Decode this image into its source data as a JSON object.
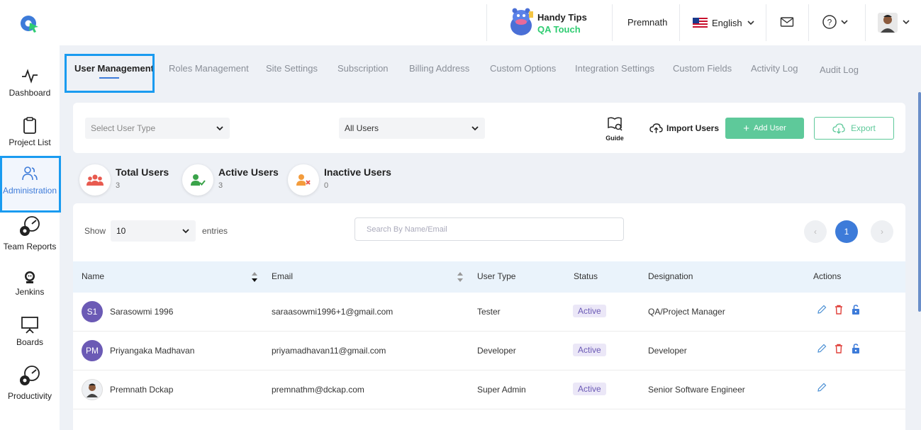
{
  "header": {
    "handy_tips": {
      "line1": "Handy Tips",
      "line2": "QA Touch"
    },
    "user_name": "Premnath",
    "language": "English"
  },
  "sidebar": {
    "items": [
      {
        "label": "Dashboard",
        "icon": "pulse-icon"
      },
      {
        "label": "Project List",
        "icon": "clipboard-icon"
      },
      {
        "label": "Administration",
        "icon": "users-icon"
      },
      {
        "label": "Team Reports",
        "icon": "gauge-gear-icon"
      },
      {
        "label": "Jenkins",
        "icon": "jenkins-icon"
      },
      {
        "label": "Boards",
        "icon": "board-icon"
      },
      {
        "label": "Productivity",
        "icon": "gauge-gear-icon"
      }
    ]
  },
  "tabs": [
    {
      "label": "User Management"
    },
    {
      "label": "Roles Management"
    },
    {
      "label": "Site Settings"
    },
    {
      "label": "Subscription"
    },
    {
      "label": "Billing Address"
    },
    {
      "label": "Custom Options"
    },
    {
      "label": "Integration Settings"
    },
    {
      "label": "Custom Fields"
    },
    {
      "label": "Activity Log"
    },
    {
      "label": "Audit Log"
    }
  ],
  "filters": {
    "user_type_placeholder": "Select User Type",
    "user_scope": "All Users",
    "guide_label": "Guide",
    "import_label": "Import Users",
    "add_label": "Add User",
    "export_label": "Export"
  },
  "stats": [
    {
      "label": "Total Users",
      "value": "3"
    },
    {
      "label": "Active Users",
      "value": "3"
    },
    {
      "label": "Inactive Users",
      "value": "0"
    }
  ],
  "table": {
    "show_label": "Show",
    "page_size": "10",
    "entries_label": "entries",
    "search_placeholder": "Search By Name/Email",
    "current_page": "1",
    "prev": "‹",
    "next": "›",
    "columns": [
      "Name",
      "Email",
      "User Type",
      "Status",
      "Designation",
      "Actions"
    ],
    "rows": [
      {
        "initials": "S1",
        "name": "Sarasowmi 1996",
        "email": "saraasowmi1996+1@gmail.com",
        "type": "Tester",
        "status": "Active",
        "designation": "QA/Project Manager"
      },
      {
        "initials": "PM",
        "name": "Priyangaka Madhavan",
        "email": "priyamadhavan11@gmail.com",
        "type": "Developer",
        "status": "Active",
        "designation": "Developer"
      },
      {
        "initials": "",
        "name": "Premnath Dckap",
        "email": "premnathm@dckap.com",
        "type": "Super Admin",
        "status": "Active",
        "designation": "Senior Software Engineer"
      }
    ]
  },
  "colors": {
    "accent": "#3d7bd9",
    "green": "#5ec99a",
    "highlight": "#1a9bf0",
    "badge": "#6b5ab5"
  }
}
